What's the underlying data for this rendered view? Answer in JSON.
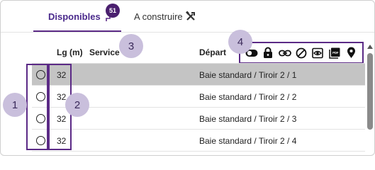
{
  "tabs": {
    "available": {
      "label": "Disponibles",
      "count": "51",
      "icon": "route-icon"
    },
    "build": {
      "label": "A construire",
      "icon": "tools-icon"
    }
  },
  "table": {
    "headers": {
      "lg": "Lg (m)",
      "service": "Service",
      "depart": "Départ"
    },
    "rows": [
      {
        "lg": "32",
        "depart": "Baie standard / Tiroir 2 / 1",
        "selected": true
      },
      {
        "lg": "32",
        "depart": "Baie standard / Tiroir 2 / 2",
        "selected": false
      },
      {
        "lg": "32",
        "depart": "Baie standard / Tiroir 2 / 3",
        "selected": false
      },
      {
        "lg": "32",
        "depart": "Baie standard / Tiroir 2 / 4",
        "selected": false
      }
    ]
  },
  "toolbar": {
    "icons": [
      "toggle-icon",
      "lock-icon",
      "link-icon",
      "forbidden-icon",
      "eye-icon",
      "pdf-icon",
      "location-pin-icon"
    ]
  },
  "callouts": [
    "1",
    "2",
    "3",
    "4"
  ],
  "colors": {
    "accent": "#5b2a86",
    "badge": "#4a1f6e",
    "callout": "#c9bfdc",
    "selected_row": "#c4c4c4"
  }
}
